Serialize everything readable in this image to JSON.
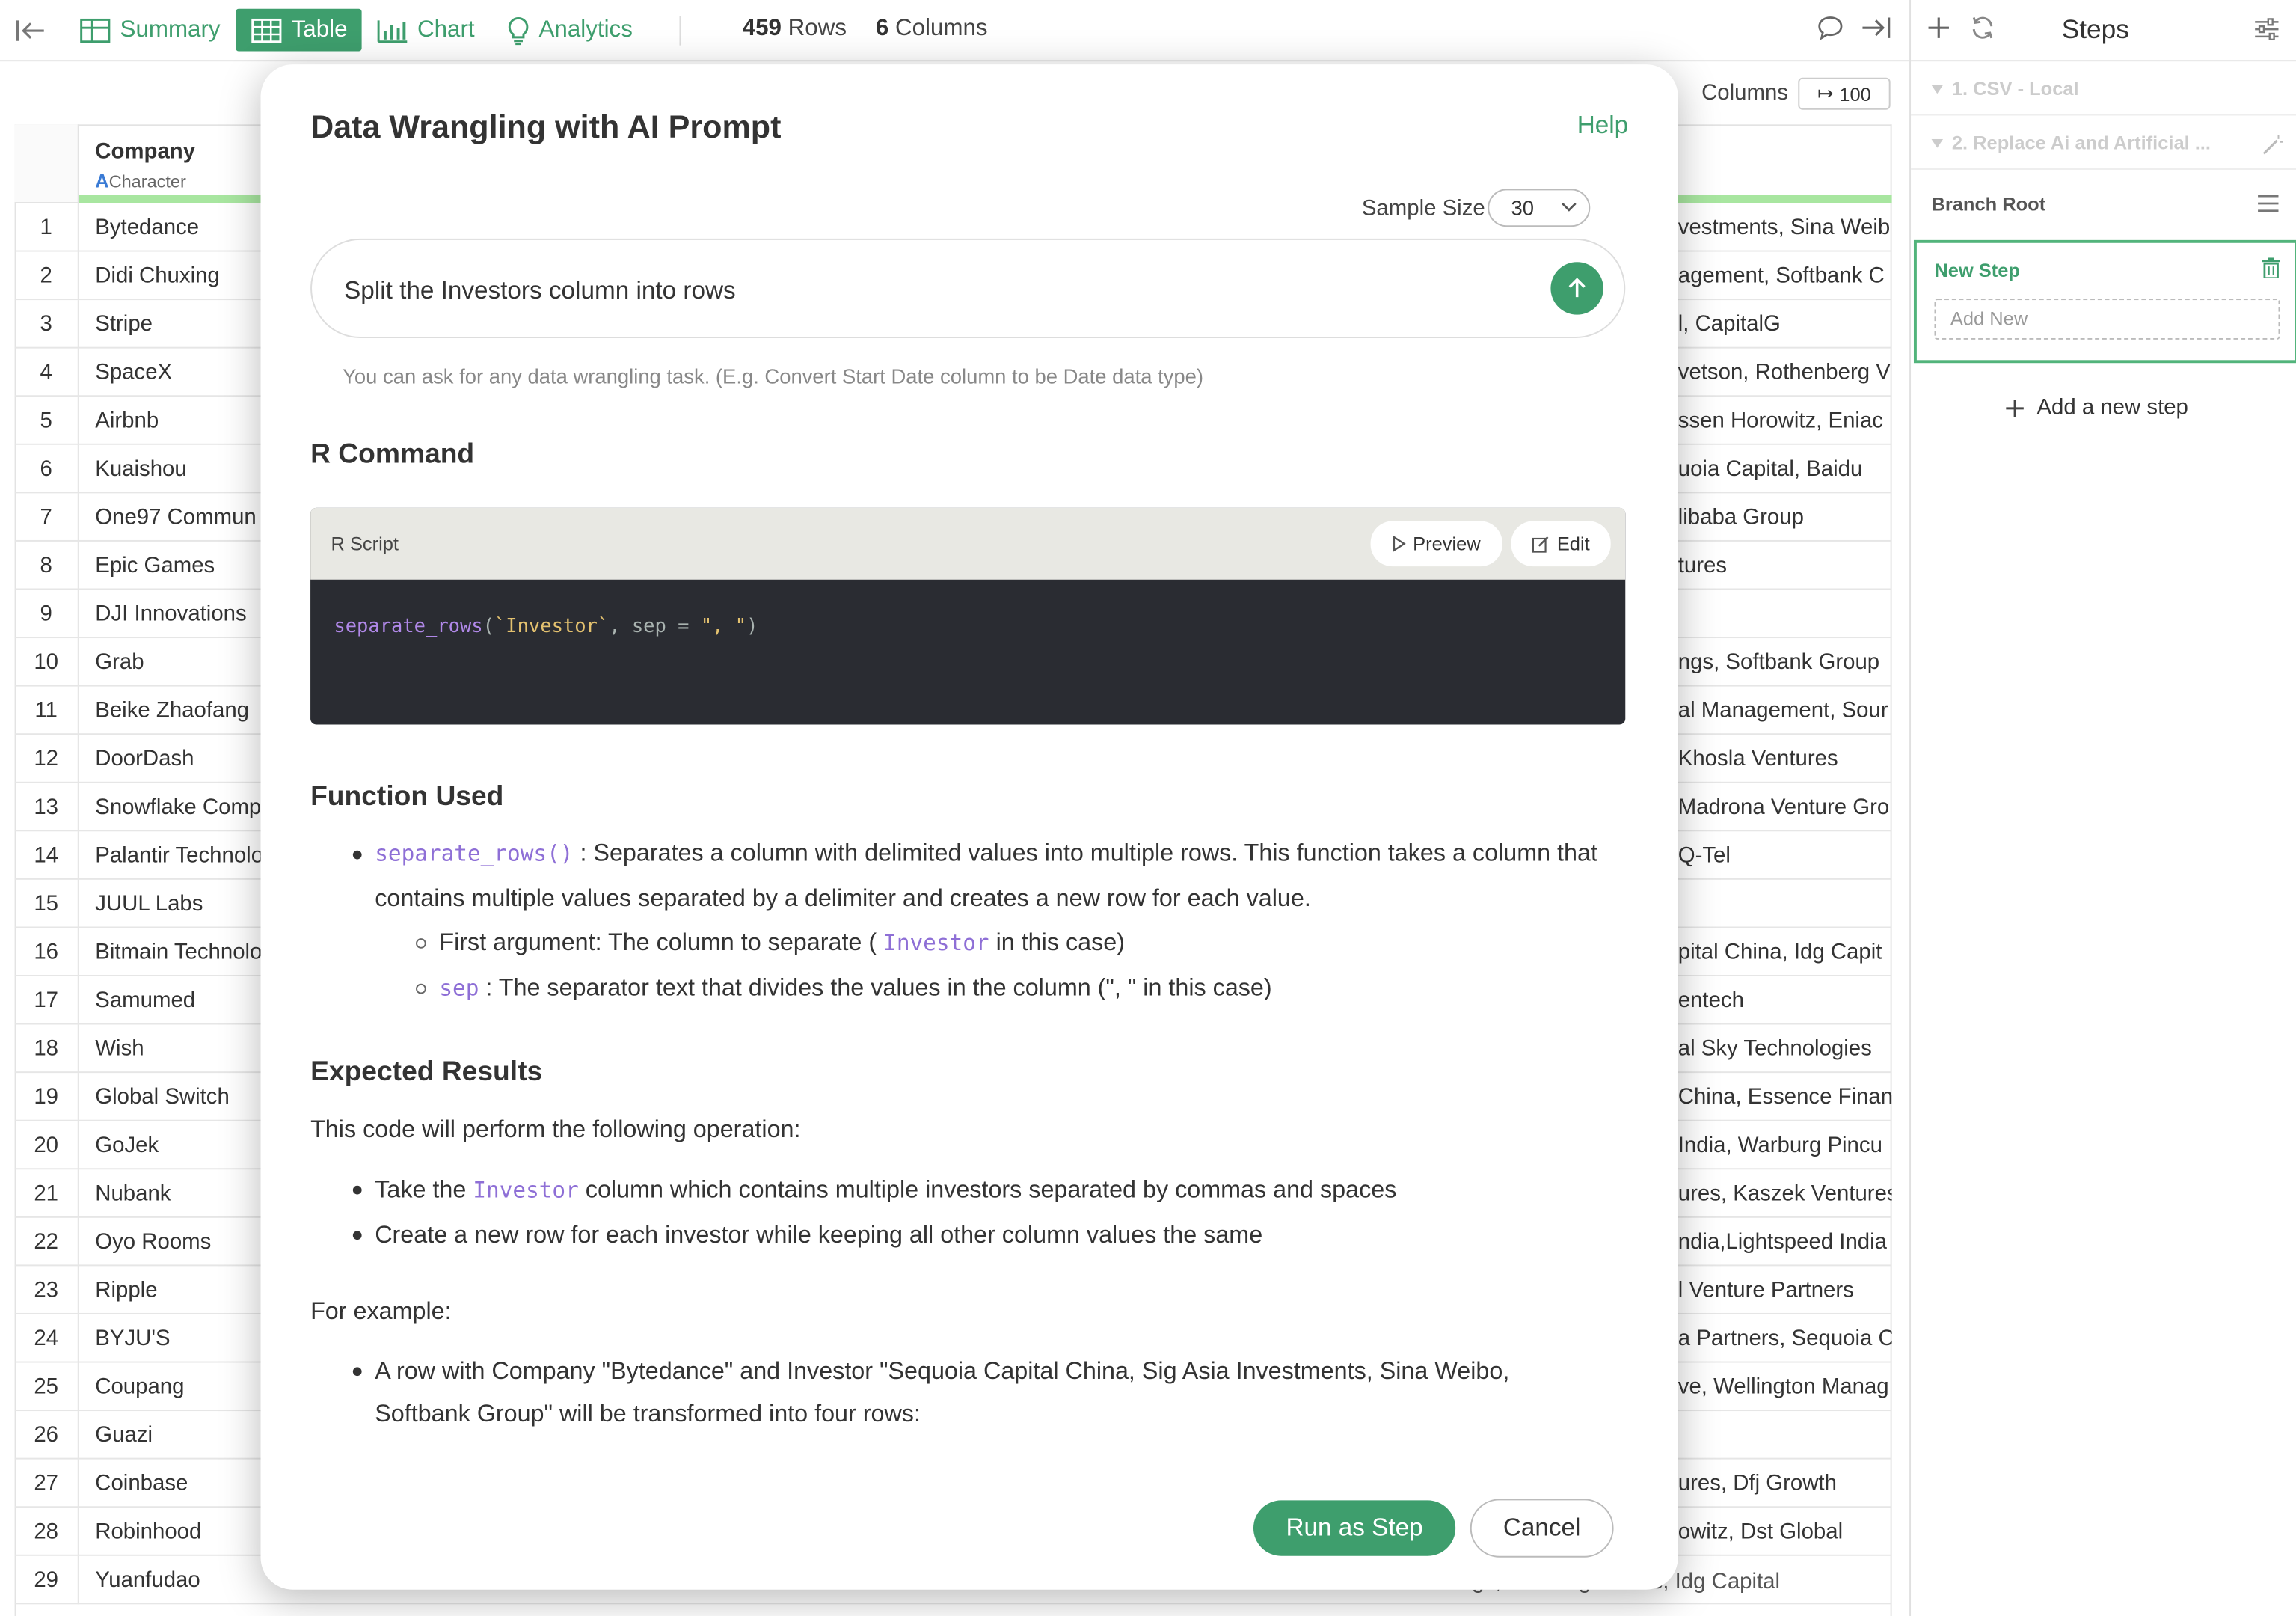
{
  "toolbar": {
    "summary_label": "Summary",
    "table_label": "Table",
    "chart_label": "Chart",
    "analytics_label": "Analytics",
    "rows_count": "459",
    "rows_label": "Rows",
    "columns_count": "6",
    "columns_label": "Columns"
  },
  "table": {
    "columns_label": "Columns",
    "columns_value": "100",
    "header_company": "Company",
    "header_type_glyph": "A",
    "header_type": "Character",
    "rows": [
      {
        "num": "1",
        "company": "Bytedance",
        "investors": "vestments, Sina Weib"
      },
      {
        "num": "2",
        "company": "Didi Chuxing",
        "investors": "agement, Softbank C"
      },
      {
        "num": "3",
        "company": "Stripe",
        "investors": "l, CapitalG"
      },
      {
        "num": "4",
        "company": "SpaceX",
        "investors": "vetson, Rothenberg V"
      },
      {
        "num": "5",
        "company": "Airbnb",
        "investors": "ssen Horowitz, Eniac"
      },
      {
        "num": "6",
        "company": "Kuaishou",
        "investors": "uoia Capital, Baidu"
      },
      {
        "num": "7",
        "company": "One97 Commun",
        "investors": "libaba Group"
      },
      {
        "num": "8",
        "company": "Epic Games",
        "investors": "tures"
      },
      {
        "num": "9",
        "company": "DJI Innovations",
        "investors": ""
      },
      {
        "num": "10",
        "company": "Grab",
        "investors": "ngs, Softbank Group"
      },
      {
        "num": "11",
        "company": "Beike Zhaofang",
        "investors": "al Management, Sour"
      },
      {
        "num": "12",
        "company": "DoorDash",
        "investors": "Khosla Ventures"
      },
      {
        "num": "13",
        "company": "Snowflake Comp",
        "investors": "Madrona Venture Gro"
      },
      {
        "num": "14",
        "company": "Palantir Technolo",
        "investors": "Q-Tel"
      },
      {
        "num": "15",
        "company": "JUUL Labs",
        "investors": ""
      },
      {
        "num": "16",
        "company": "Bitmain Technolo",
        "investors": "pital China, Idg Capit"
      },
      {
        "num": "17",
        "company": "Samumed",
        "investors": "entech"
      },
      {
        "num": "18",
        "company": "Wish",
        "investors": "al Sky Technologies"
      },
      {
        "num": "19",
        "company": "Global Switch",
        "investors": "China, Essence Financ"
      },
      {
        "num": "20",
        "company": "GoJek",
        "investors": "India, Warburg Pincu"
      },
      {
        "num": "21",
        "company": "Nubank",
        "investors": "ures, Kaszek Ventures"
      },
      {
        "num": "22",
        "company": "Oyo Rooms",
        "investors": "ndia,Lightspeed India"
      },
      {
        "num": "23",
        "company": "Ripple",
        "investors": "l Venture Partners"
      },
      {
        "num": "24",
        "company": "BYJU'S",
        "investors": "a Partners, Sequoia C"
      },
      {
        "num": "25",
        "company": "Coupang",
        "investors": "ve, Wellington Manag"
      },
      {
        "num": "26",
        "company": "Guazi",
        "investors": ""
      },
      {
        "num": "27",
        "company": "Coinbase",
        "investors": "ures, Dfj Growth"
      },
      {
        "num": "28",
        "company": "Robinhood",
        "investors": "owitz, Dst Global"
      },
      {
        "num": "29",
        "company": "Yuanfudao",
        "investors": ""
      }
    ],
    "row29_tail": "Tencent Holdings, Warburg Pincus, Idg Capital"
  },
  "steps": {
    "title": "Steps",
    "step1": "1. CSV - Local",
    "step2": "2. Replace Ai and Artificial ...",
    "branch_root": "Branch Root",
    "new_step_title": "New Step",
    "add_new_placeholder": "Add New",
    "add_new_step": "Add a new step"
  },
  "dialog": {
    "title": "Data Wrangling with AI Prompt",
    "help": "Help",
    "sample_size_label": "Sample Size",
    "sample_size_value": "30",
    "prompt_text": "Split the Investors column into rows",
    "hint": "You can ask for any data wrangling task. (E.g. Convert Start Date column to be Date data type)",
    "r_command_title": "R Command",
    "r_script_label": "R Script",
    "preview_label": "Preview",
    "edit_label": "Edit",
    "code": {
      "fn": "separate_rows",
      "open": "(",
      "arg": "`Investor`",
      "mid": ", sep = ",
      "str": "\", \"",
      "close": ")"
    },
    "function_used_title": "Function Used",
    "func_name": "separate_rows()",
    "func_desc_1": ": Separates a column with delimited values into multiple rows. This function takes a column that",
    "func_desc_2": "contains multiple values separated by a delimiter and creates a new row for each value.",
    "arg1_prefix": "First argument: The column to separate (",
    "arg1_code": "Investor",
    "arg1_suffix": "in this case)",
    "arg2_code": "sep",
    "arg2_text": ": The separator text that divides the values in the column (\", \" in this case)",
    "expected_title": "Expected Results",
    "expected_intro": "This code will perform the following operation:",
    "exp1_prefix": "Take the",
    "exp1_code": "Investor",
    "exp1_suffix": "column which contains multiple investors separated by commas and spaces",
    "exp2": "Create a new row for each investor while keeping all other column values the same",
    "for_example": "For example:",
    "example_1": "A row with Company \"Bytedance\" and Investor \"Sequoia Capital China, Sig Asia Investments, Sina Weibo,",
    "example_2": "Softbank Group\" will be transformed into four rows:",
    "run_label": "Run as Step",
    "cancel_label": "Cancel"
  },
  "colors": {
    "accent": "#3e9e6d",
    "code_bg": "#2a2c32",
    "code_header": "#e8e8e3",
    "column_bar": "#a8e6a0"
  }
}
